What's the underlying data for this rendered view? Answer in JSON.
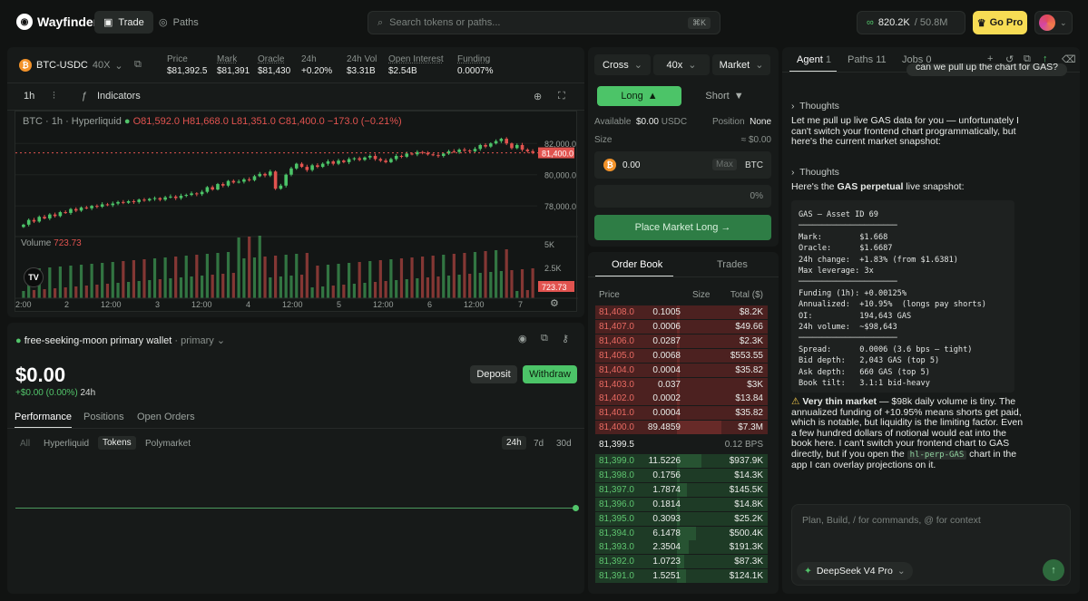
{
  "app": {
    "name": "Wayfinder",
    "nav": [
      {
        "label": "Trade"
      },
      {
        "label": "Paths"
      }
    ],
    "search_placeholder": "Search tokens or paths...",
    "search_kbd": "⌘K",
    "balance": "820.2K",
    "balance_sub": "/ 50.8M",
    "gopro": "Go Pro"
  },
  "ticker": {
    "pair": "BTC-USDC",
    "leverage": "40X",
    "stats": [
      {
        "label": "Price",
        "value": "$81,392.5"
      },
      {
        "label": "Mark",
        "value": "$81,391"
      },
      {
        "label": "Oracle",
        "value": "$81,430"
      },
      {
        "label": "24h",
        "value": "+0.20%"
      },
      {
        "label": "24h Vol",
        "value": "$3.31B"
      },
      {
        "label": "Open Interest",
        "value": "$2.54B"
      },
      {
        "label": "Funding",
        "value": "0.0007%"
      }
    ]
  },
  "chart_toolbar": {
    "interval": "1h",
    "indicators": "Indicators"
  },
  "chart_data": {
    "type": "candlestick",
    "title": "BTC · 1h · Hyperliquid",
    "ohlc": {
      "o": "81,592.0",
      "h": "81,668.0",
      "l": "81,351.0",
      "c": "81,400.0",
      "change": "−173.0 (−0.21%)"
    },
    "yticks": [
      "82,000.0",
      "80,000.0",
      "78,000.0"
    ],
    "last_price": "81,400.0",
    "volume_label": "Volume",
    "volume_value": "723.73",
    "vol_ticks": [
      "5K",
      "2.5K"
    ],
    "vol_last": "723.73",
    "xticks": [
      "2:00",
      "2",
      "12:00",
      "3",
      "12:00",
      "4",
      "12:00",
      "5",
      "12:00",
      "6",
      "12:00",
      "7"
    ],
    "ylim": [
      76500,
      83000
    ],
    "closes": [
      76800,
      77100,
      77000,
      77300,
      77200,
      77450,
      77350,
      77600,
      77550,
      77800,
      77700,
      77900,
      77850,
      78000,
      77950,
      78100,
      78050,
      78150,
      78250,
      78200,
      78300,
      78250,
      78400,
      78350,
      78450,
      78500,
      78400,
      78550,
      78600,
      78500,
      78650,
      78700,
      78800,
      78750,
      78900,
      79200,
      79050,
      79400,
      79300,
      79600,
      79500,
      79550,
      79700,
      79650,
      79900,
      80050,
      79950,
      80200,
      79100,
      79300,
      80000,
      80400,
      80700,
      80500,
      80300,
      80600,
      80500,
      80700,
      80850,
      80700,
      80900,
      80800,
      81000,
      81050,
      80950,
      81100,
      81200,
      81000,
      80900,
      80800,
      81000,
      81200,
      81150,
      81350,
      81300,
      81450,
      81400,
      81300,
      81250,
      81200,
      81350,
      81500,
      81450,
      81600,
      81550,
      81500,
      81650,
      81900,
      81800,
      82000,
      82150,
      82300,
      82000,
      81700,
      81900,
      81600,
      81500,
      81400
    ]
  },
  "wallet": {
    "name": "free-seeking-moon primary wallet",
    "tag": "· primary",
    "balance": "$0.00",
    "change": "+$0.00 (0.00%)",
    "period": "24h",
    "deposit": "Deposit",
    "withdraw": "Withdraw",
    "tabs": [
      "Performance",
      "Positions",
      "Open Orders"
    ],
    "filters": [
      "All",
      "Hyperliquid",
      "Tokens",
      "Polymarket"
    ],
    "ranges": [
      "24h",
      "7d",
      "30d"
    ]
  },
  "order": {
    "margin": "Cross",
    "leverage": "40x",
    "type": "Market",
    "long": "Long",
    "short": "Short",
    "available_label": "Available",
    "available_value": "$0.00",
    "available_unit": "USDC",
    "position_label": "Position",
    "position_value": "None",
    "size_label": "Size",
    "size_value": "≈ $0.00",
    "amount": "0.00",
    "max": "Max",
    "unit": "BTC",
    "pct": "0%",
    "submit": "Place Market Long →"
  },
  "book": {
    "tabs": [
      "Order Book",
      "Trades"
    ],
    "headers": [
      "Price",
      "Size",
      "Total ($)"
    ],
    "asks": [
      [
        "81,408.0",
        "0.1005",
        "$8.2K"
      ],
      [
        "81,407.0",
        "0.0006",
        "$49.66"
      ],
      [
        "81,406.0",
        "0.0287",
        "$2.3K"
      ],
      [
        "81,405.0",
        "0.0068",
        "$553.55"
      ],
      [
        "81,404.0",
        "0.0004",
        "$35.82"
      ],
      [
        "81,403.0",
        "0.037",
        "$3K"
      ],
      [
        "81,402.0",
        "0.0002",
        "$13.84"
      ],
      [
        "81,401.0",
        "0.0004",
        "$35.82"
      ],
      [
        "81,400.0",
        "89.4859",
        "$7.3M"
      ]
    ],
    "mid": "81,399.5",
    "spread": "0.12 BPS",
    "bids": [
      [
        "81,399.0",
        "11.5226",
        "$937.9K"
      ],
      [
        "81,398.0",
        "0.1756",
        "$14.3K"
      ],
      [
        "81,397.0",
        "1.7874",
        "$145.5K"
      ],
      [
        "81,396.0",
        "0.1814",
        "$14.8K"
      ],
      [
        "81,395.0",
        "0.3093",
        "$25.2K"
      ],
      [
        "81,394.0",
        "6.1478",
        "$500.4K"
      ],
      [
        "81,393.0",
        "2.3504",
        "$191.3K"
      ],
      [
        "81,392.0",
        "1.0723",
        "$87.3K"
      ],
      [
        "81,391.0",
        "1.5251",
        "$124.1K"
      ]
    ]
  },
  "agent": {
    "tabs": [
      {
        "label": "Agent",
        "count": "1"
      },
      {
        "label": "Paths",
        "count": "11"
      },
      {
        "label": "Jobs",
        "count": "0"
      }
    ],
    "user_msg": "can we pull up the chart for GAS?",
    "thoughts": "Thoughts",
    "msg1": "Let me pull up live GAS data for you — unfortunately I can't switch your frontend chart programmatically, but here's the current market snapshot:",
    "msg2_pre": "Here's the ",
    "msg2_bold": "GAS perpetual",
    "msg2_post": " live snapshot:",
    "code": "GAS — Asset ID 69\n─────────────────────\nMark:        $1.668\nOracle:      $1.6687\n24h change:  +1.83% (from $1.6381)\nMax leverage: 3x\n─────────────────────\nFunding (1h): +0.00125%\nAnnualized:  +10.95%  (longs pay shorts)\nOI:          194,643 GAS\n24h volume:  ~$98,643\n─────────────────────\nSpread:      0.0006 (3.6 bps — tight)\nBid depth:   2,043 GAS (top 5)\nAsk depth:   660 GAS (top 5)\nBook tilt:   3.1:1 bid-heavy",
    "warn_bold": "Very thin market",
    "warn_text": " — $98k daily volume is tiny. The annualized funding of +10.95% means shorts get paid, which is notable, but liquidity is the limiting factor. Even a few hundred dollars of notional would eat into the book here. I can't switch your frontend chart to GAS directly, but if you open the ",
    "warn_code": "hl-perp-GAS",
    "warn_end": " chart in the app I can overlay projections on it.",
    "input_placeholder": "Plan, Build, / for commands, @ for context",
    "model": "DeepSeek V4 Pro"
  }
}
